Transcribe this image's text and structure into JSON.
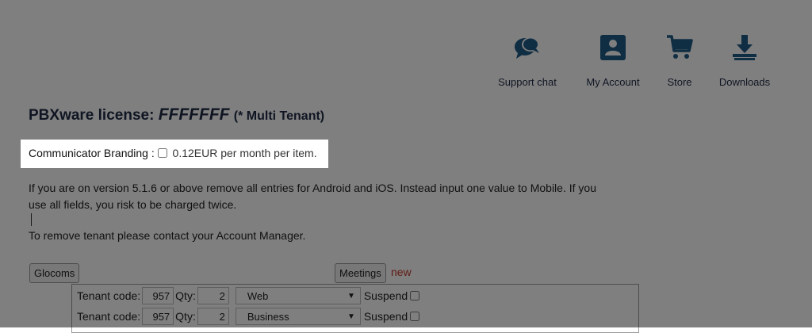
{
  "nav": {
    "items": [
      {
        "label": "Support chat",
        "icon": "chat-bubbles-icon"
      },
      {
        "label": "My Account",
        "icon": "account-card-icon"
      },
      {
        "label": "Store",
        "icon": "shopping-cart-icon"
      },
      {
        "label": "Downloads",
        "icon": "download-icon"
      }
    ]
  },
  "license": {
    "prefix": "PBXware license:",
    "key": "FFFFFFF",
    "type": "(* Multi Tenant)"
  },
  "branding": {
    "label": "Communicator Branding :",
    "price": "0.12EUR per month per item.",
    "checked": false
  },
  "info": {
    "line1": "If you are on version 5.1.6 or above remove all entries for Android and iOS. Instead input one value to Mobile. If you",
    "line2": "use all fields, you risk to be charged twice.",
    "remove_note": "To remove tenant please contact your Account Manager."
  },
  "buttons": {
    "glocoms": "Glocoms",
    "meetings": "Meetings",
    "new_badge": "new"
  },
  "tenants": {
    "tenant_label": "Tenant code:",
    "qty_label": "Qty:",
    "suspend_label": "Suspend",
    "rows": [
      {
        "code": "957",
        "qty": "2",
        "platform": "Web"
      },
      {
        "code": "957",
        "qty": "2",
        "platform": "Business"
      }
    ]
  },
  "colors": {
    "nav_icon": "#1e5a86",
    "title_text": "#1f2a44",
    "new_badge": "#c0392b",
    "overlay": "#000000"
  }
}
